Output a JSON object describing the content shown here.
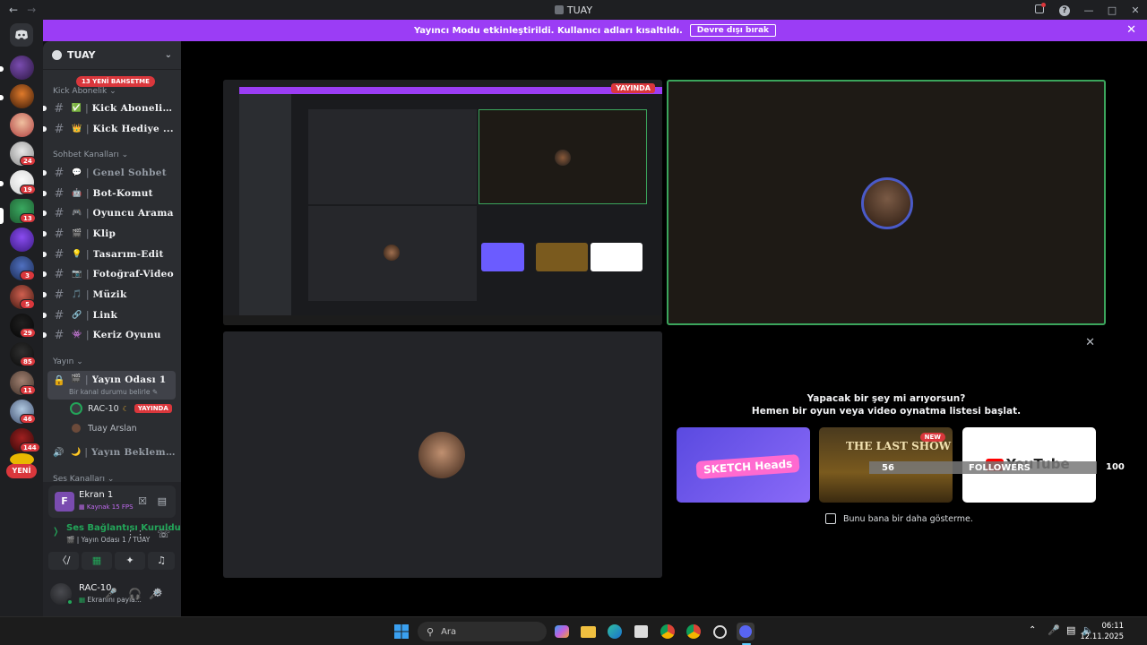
{
  "window": {
    "title": "TUAY"
  },
  "banner": {
    "message": "Yayıncı Modu etkinleştirildi. Kullanıcı adları kısaltıldı.",
    "button": "Devre dışı bırak"
  },
  "rail": {
    "badges": [
      "24",
      "19",
      "13",
      "3",
      "5",
      "29",
      "85",
      "11",
      "46",
      "144"
    ],
    "new_label": "YENİ"
  },
  "sidebar": {
    "server_name": "TUAY",
    "new_mentions": "13 YENİ BAHSETME",
    "categories": {
      "kick": "Kick Abonelik",
      "chat": "Sohbet Kanalları",
      "stream": "Yayın",
      "voice": "Ses Kanalları"
    },
    "channels": [
      {
        "name": "Kick Abonelik...",
        "emoji": "✅"
      },
      {
        "name": "Kick Hediye ...",
        "emoji": "👑"
      },
      {
        "name": "Genel Sohbet",
        "emoji": "💬"
      },
      {
        "name": "Bot-Komut",
        "emoji": "🤖"
      },
      {
        "name": "Oyuncu Arama",
        "emoji": "🎮"
      },
      {
        "name": "Klip",
        "emoji": "🎬"
      },
      {
        "name": "Tasarım-Edit",
        "emoji": "💡"
      },
      {
        "name": "Fotoğraf-Video",
        "emoji": "📷"
      },
      {
        "name": "Müzik",
        "emoji": "🎵"
      },
      {
        "name": "Link",
        "emoji": "🔗"
      },
      {
        "name": "Keriz Oyunu",
        "emoji": "👾"
      }
    ],
    "stream_room": {
      "name": "Yayın Odası 1",
      "status": "Bir kanal durumu belirle",
      "users": [
        {
          "name": "RAC-10",
          "live": "YAYINDA"
        },
        {
          "name": "Tuay Arslan"
        }
      ]
    },
    "waiting_room": "Yayın Bekleme..."
  },
  "panel": {
    "screen": {
      "title": "Ekran 1",
      "sub": "Kaynak 15 FPS"
    },
    "voice": {
      "status": "Ses Bağlantısı Kuruldu",
      "channel": "Yayın Odası 1 / TUAY"
    },
    "user": {
      "name": "RAC-10",
      "status": "Ekranını payla..."
    }
  },
  "stage": {
    "live_tag": "YAYINDA",
    "activity": {
      "title": "Yapacak bir şey mi arıyorsun?",
      "subtitle": "Hemen bir oyun veya video oynatma listesi başlat.",
      "cards": [
        {
          "name": "SKETCH Heads",
          "color": "#6b5cff"
        },
        {
          "name": "THE LAST SHOW",
          "badge": "NEW",
          "color": "#7a5a1e"
        },
        {
          "name": "YouTube",
          "color": "#ffffff"
        }
      ],
      "checkbox_label": "Bunu bana bir daha gösterme."
    },
    "followers": {
      "left_count": "56",
      "label": "FOLLOWERS",
      "right_count": "100"
    }
  },
  "taskbar": {
    "search_placeholder": "Ara",
    "time": "06:11",
    "date": "12.11.2025"
  }
}
